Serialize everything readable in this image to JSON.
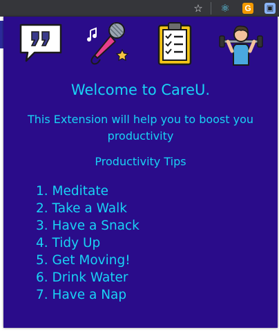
{
  "browser": {
    "star_icon": "star-icon",
    "extensions": [
      "react-devtools-icon",
      "grammarly-g-icon",
      "extension-puzzle-icon"
    ],
    "g_letter": "G",
    "toolbar_color": "#35363a"
  },
  "popup": {
    "background_color": "#2a0c8a",
    "text_color": "#19d3f5",
    "icons": [
      "quote-speech-bubble-icon",
      "microphone-music-icon",
      "clipboard-checklist-icon",
      "weightlifter-icon"
    ],
    "title": "Welcome to CareU.",
    "subtitle": "This Extension will help you to boost you productivity",
    "tips_heading": "Productivity Tips",
    "tips": [
      "1. Meditate",
      "2. Take a Walk",
      "3. Have a Snack",
      "4. Tidy Up",
      "5. Get Moving!",
      "6. Drink Water",
      "7. Have a Nap"
    ]
  }
}
